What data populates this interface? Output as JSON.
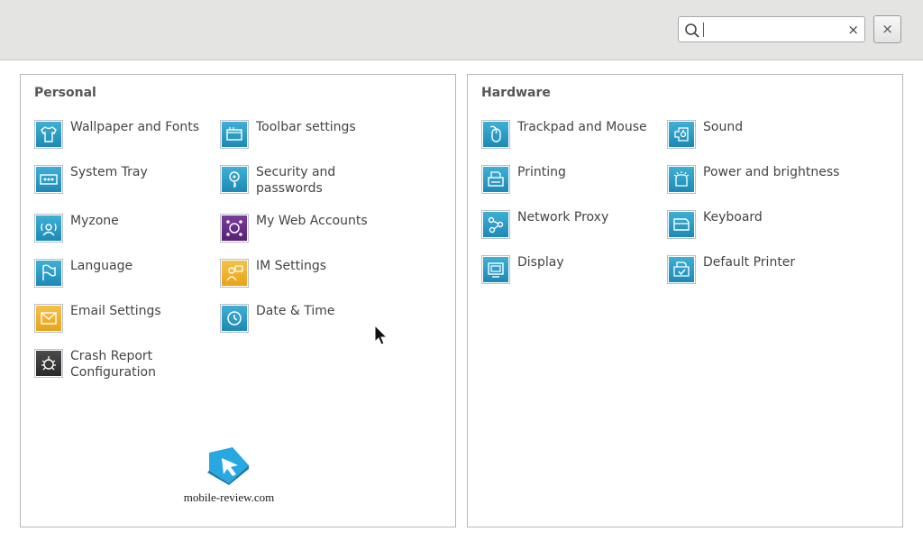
{
  "search": {
    "placeholder": "",
    "value": "",
    "clear_glyph": "×"
  },
  "window": {
    "close_glyph": "×"
  },
  "personal": {
    "title": "Personal",
    "items": [
      {
        "label": "Wallpaper and Fonts",
        "icon": "shirt-icon"
      },
      {
        "label": "Toolbar settings",
        "icon": "toolbar-icon"
      },
      {
        "label": "System Tray",
        "icon": "tray-icon"
      },
      {
        "label": "Security and\npasswords",
        "icon": "key-icon"
      },
      {
        "label": "Myzone",
        "icon": "myzone-icon"
      },
      {
        "label": "My Web Accounts",
        "icon": "web-accounts-icon"
      },
      {
        "label": "Language",
        "icon": "flag-icon"
      },
      {
        "label": "IM Settings",
        "icon": "im-people-icon"
      },
      {
        "label": "Email Settings",
        "icon": "envelope-icon"
      },
      {
        "label": "Date & Time",
        "icon": "clock-icon"
      },
      {
        "label": "Crash Report\nConfiguration",
        "icon": "bug-icon"
      }
    ]
  },
  "hardware": {
    "title": "Hardware",
    "items": [
      {
        "label": "Trackpad and Mouse",
        "icon": "mouse-icon"
      },
      {
        "label": "Sound",
        "icon": "speaker-icon"
      },
      {
        "label": "Printing",
        "icon": "printer-icon"
      },
      {
        "label": "Power and brightness",
        "icon": "power-icon"
      },
      {
        "label": "Network Proxy",
        "icon": "network-icon"
      },
      {
        "label": "Keyboard",
        "icon": "keyboard-icon"
      },
      {
        "label": "Display",
        "icon": "monitor-icon"
      },
      {
        "label": "Default Printer",
        "icon": "default-printer-icon"
      }
    ]
  },
  "watermark": {
    "text": "mobile-review.com"
  },
  "colors": {
    "teal": "#2a9cc6",
    "purple": "#63297f",
    "orange": "#f0b42f",
    "dark": "#333333"
  }
}
